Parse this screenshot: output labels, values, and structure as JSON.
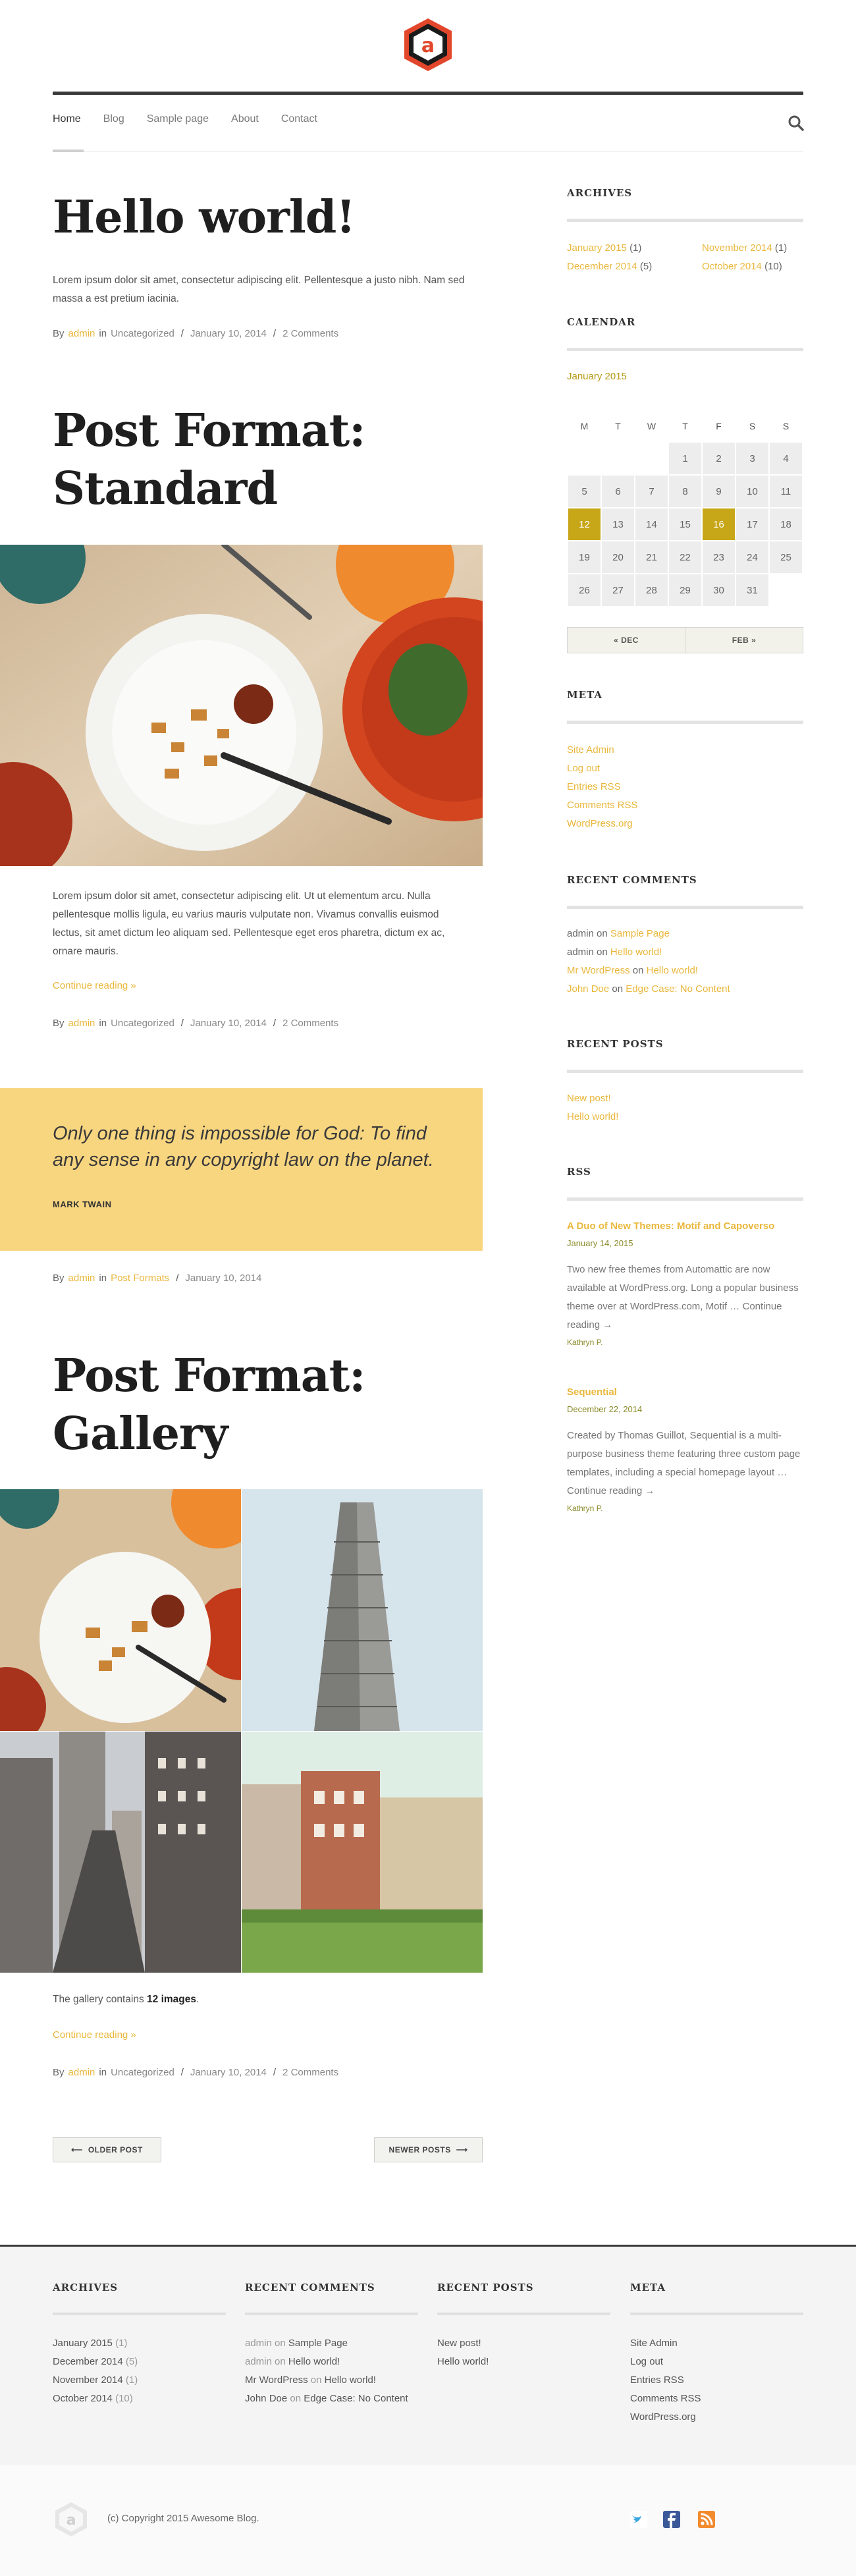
{
  "header": {
    "logo_letter": "a",
    "nav": [
      "Home",
      "Blog",
      "Sample page",
      "About",
      "Contact"
    ]
  },
  "posts": [
    {
      "title": "Hello world!",
      "excerpt": "Lorem ipsum dolor sit amet, consectetur adipiscing elit. Pellentesque a justo nibh. Nam sed massa a est pretium iacinia.",
      "meta": {
        "by": "By",
        "author": "admin",
        "in": "in",
        "category": "Uncategorized",
        "date": "January 10, 2014",
        "comments": "2 Comments"
      }
    },
    {
      "title_line1": "Post Format:",
      "title_line2": "Standard",
      "excerpt": "Lorem ipsum dolor sit amet, consectetur adipiscing elit. Ut ut elementum arcu. Nulla pellentesque mollis ligula, eu varius mauris vulputate non. Vivamus convallis euismod lectus, sit amet dictum leo aliquam sed. Pellentesque eget eros pharetra, dictum ex ac, ornare mauris.",
      "continue": "Continue reading »",
      "meta": {
        "by": "By",
        "author": "admin",
        "in": "in",
        "category": "Uncategorized",
        "date": "January 10, 2014",
        "comments": "2 Comments"
      }
    },
    {
      "quote": "Only one thing is impossible for God: To find any sense in any copyright law on the planet.",
      "author": "MARK TWAIN",
      "meta": {
        "by": "By",
        "author": "admin",
        "in": "in",
        "category": "Post Formats",
        "date": "January 10, 2014"
      }
    },
    {
      "title_line1": "Post Format:",
      "title_line2": "Gallery",
      "gallery_text_prefix": "The gallery contains",
      "gallery_count": "12 images",
      "continue": "Continue reading »",
      "meta": {
        "by": "By",
        "author": "admin",
        "in": "in",
        "category": "Uncategorized",
        "date": "January 10, 2014",
        "comments": "2 Comments"
      }
    }
  ],
  "pagination": {
    "older": "OLDER POST",
    "newer": "NEWER POSTS"
  },
  "sidebar": {
    "archives": {
      "title": "ARCHIVES",
      "items": [
        {
          "label": "January 2015",
          "count": "(1)"
        },
        {
          "label": "November 2014",
          "count": "(1)"
        },
        {
          "label": "December 2014",
          "count": "(5)"
        },
        {
          "label": "October 2014",
          "count": "(10)"
        }
      ]
    },
    "calendar": {
      "title": "CALENDAR",
      "caption": "January 2015",
      "days": [
        "M",
        "T",
        "W",
        "T",
        "F",
        "S",
        "S"
      ],
      "prev": "« DEC",
      "next": "FEB »"
    },
    "meta": {
      "title": "META",
      "items": [
        "Site Admin",
        "Log out",
        "Entries RSS",
        "Comments RSS",
        "WordPress.org"
      ]
    },
    "recent_comments": {
      "title": "RECENT COMMENTS",
      "items": [
        {
          "author": "admin",
          "on": "on",
          "post": "Sample Page"
        },
        {
          "author": "admin",
          "on": "on",
          "post": "Hello world!"
        },
        {
          "author": "Mr WordPress",
          "on": "on",
          "post": "Hello world!"
        },
        {
          "author": "John Doe",
          "on": "on",
          "post": "Edge Case: No Content"
        }
      ]
    },
    "recent_posts": {
      "title": "RECENT POSTS",
      "items": [
        "New post!",
        "Hello world!"
      ]
    },
    "rss": {
      "title": "RSS",
      "items": [
        {
          "title": "A Duo of New Themes: Motif and Capoverso",
          "date": "January 14, 2015",
          "text": "Two new free themes from Automattic are now available at WordPress.org. Long a popular business theme over at WordPress.com, Motif …",
          "continue": "Continue reading →",
          "author": "Kathryn P."
        },
        {
          "title": "Sequential",
          "date": "December 22, 2014",
          "text": "Created by Thomas Guillot, Sequential is a multi-purpose business theme featuring three custom page templates, including a special homepage layout …",
          "continue": "Continue reading →",
          "author": "Kathryn P."
        }
      ]
    }
  },
  "footer": {
    "archives": {
      "title": "ARCHIVES",
      "items": [
        {
          "label": "January 2015",
          "count": "(1)"
        },
        {
          "label": "December 2014",
          "count": "(5)"
        },
        {
          "label": "November 2014",
          "count": "(1)"
        },
        {
          "label": "October 2014",
          "count": "(10)"
        }
      ]
    },
    "recent_comments": {
      "title": "RECENT COMMENTS",
      "items": [
        {
          "author": "admin",
          "on": "on",
          "post": "Sample Page"
        },
        {
          "author": "admin",
          "on": "on",
          "post": "Hello world!"
        },
        {
          "author": "Mr WordPress",
          "on": "on",
          "post": "Hello world!"
        },
        {
          "author": "John Doe",
          "on": "on",
          "post": "Edge Case: No Content"
        }
      ]
    },
    "recent_posts": {
      "title": "RECENT POSTS",
      "items": [
        "New post!",
        "Hello world!"
      ]
    },
    "meta": {
      "title": "META",
      "items": [
        "Site Admin",
        "Log out",
        "Entries RSS",
        "Comments RSS",
        "WordPress.org"
      ]
    },
    "copyright": "(c) Copyright 2015 Awesome Blog.",
    "social_icons": [
      "twitter-icon",
      "facebook-icon",
      "rss-icon"
    ]
  },
  "colors": {
    "accent": "#e9b73b",
    "logo": "#e2472b",
    "calendar_highlight": "#c7a618",
    "quote_bg": "#f8d680",
    "dark": "#3a3a3a"
  }
}
